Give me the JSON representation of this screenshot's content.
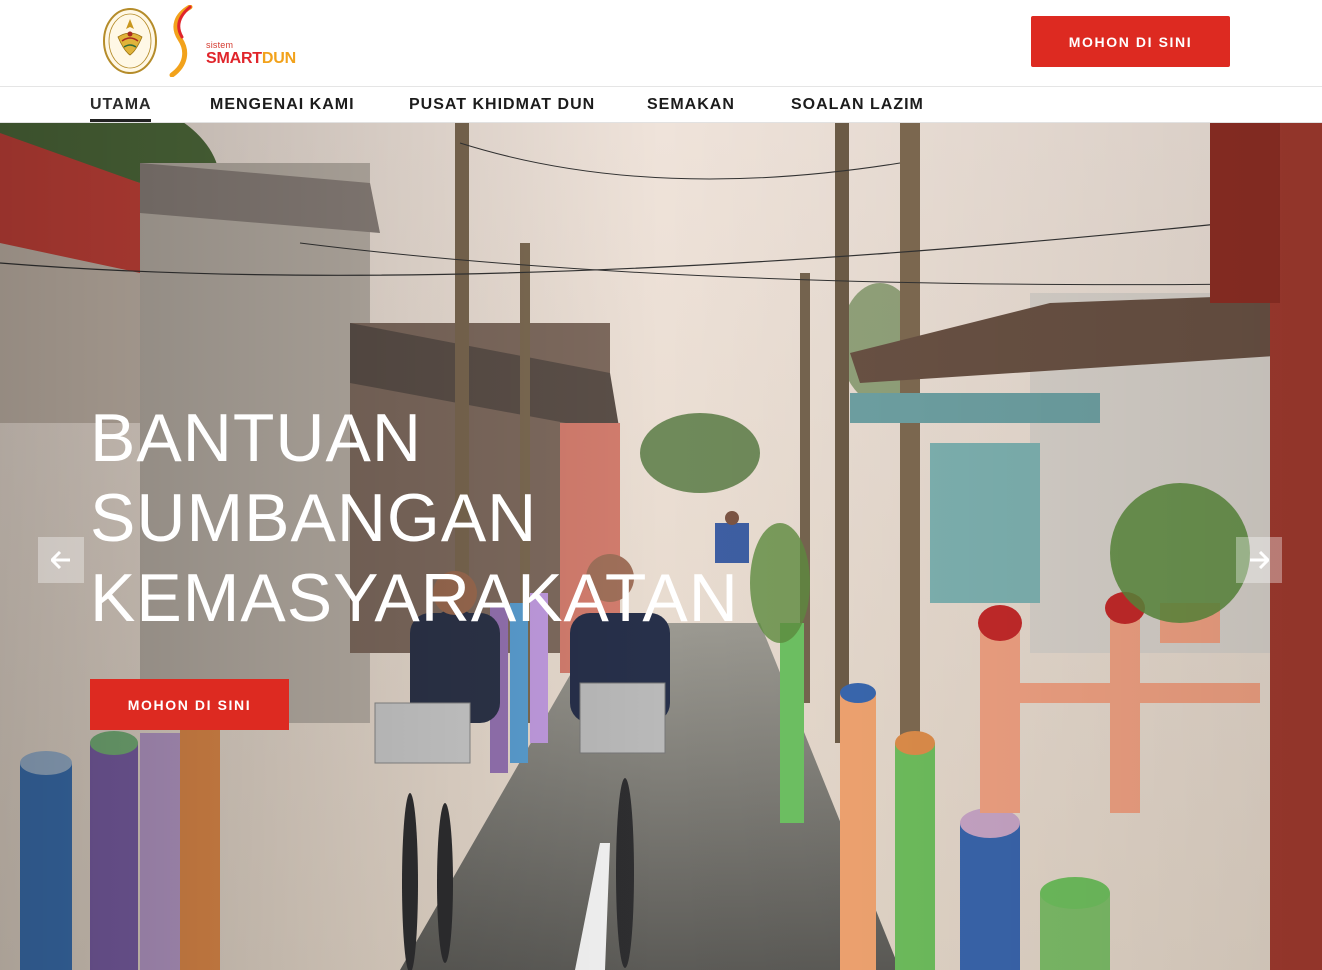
{
  "header": {
    "brand_small": "sistem",
    "brand_smart": "SMART",
    "brand_dun": "DUN",
    "apply_label": "MOHON DI SINI"
  },
  "nav": {
    "items": [
      {
        "label": "UTAMA",
        "active": true
      },
      {
        "label": "MENGENAI KAMI"
      },
      {
        "label": "PUSAT KHIDMAT DUN"
      },
      {
        "label": "SEMAKAN"
      },
      {
        "label": "SOALAN LAZIM"
      }
    ]
  },
  "hero": {
    "title_line1": "BANTUAN",
    "title_line2": "SUMBANGAN",
    "title_line3": "KEMASYARAKATAN",
    "apply_label": "MOHON DI SINI",
    "prev_icon": "arrow-left-icon",
    "next_icon": "arrow-right-icon"
  },
  "colors": {
    "accent_red": "#dd2a21",
    "brand_orange": "#f2a21b"
  }
}
